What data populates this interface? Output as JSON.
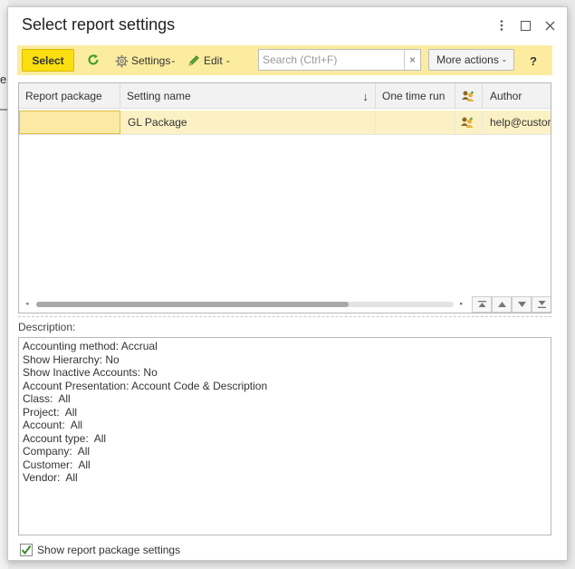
{
  "background": {
    "fragment_text": "e"
  },
  "dialog": {
    "title": "Select report settings",
    "more_icon": "kebab-icon",
    "maximize_icon": "maximize-icon",
    "close_icon": "close-icon"
  },
  "toolbar": {
    "select_label": "Select",
    "refresh_icon": "refresh-icon",
    "settings_label": "Settings",
    "edit_label": "Edit",
    "search_placeholder": "Search (Ctrl+F)",
    "search_value": "",
    "search_clear": "×",
    "more_actions_label": "More actions",
    "help_label": "?"
  },
  "grid": {
    "columns": [
      {
        "label": "Report package"
      },
      {
        "label": "Setting name"
      },
      {
        "label": "One time run"
      },
      {
        "label": "",
        "icon": "users-icon"
      },
      {
        "label": "Author"
      }
    ],
    "sort_indicator": "↓",
    "rows": [
      {
        "report_package": "",
        "setting_name": "GL Package",
        "one_time_run": "",
        "shared_icon": "users-icon",
        "author": "help@custor"
      }
    ]
  },
  "description": {
    "label": "Description:",
    "lines": [
      "Accounting method: Accrual",
      "Show Hierarchy: No",
      "Show Inactive Accounts: No",
      "Account Presentation: Account Code & Description",
      "Class:  All",
      "Project:  All",
      "Account:  All",
      "Account type:  All",
      "Company:  All",
      "Customer:  All",
      "Vendor:  All"
    ]
  },
  "footer": {
    "show_package_label": "Show report package settings",
    "show_package_checked": true
  },
  "colors": {
    "toolbar_bg": "#fcec9f",
    "select_button": "#fbde0f",
    "row_selected": "#fbf1c5",
    "check_green": "#3a8a2a"
  }
}
